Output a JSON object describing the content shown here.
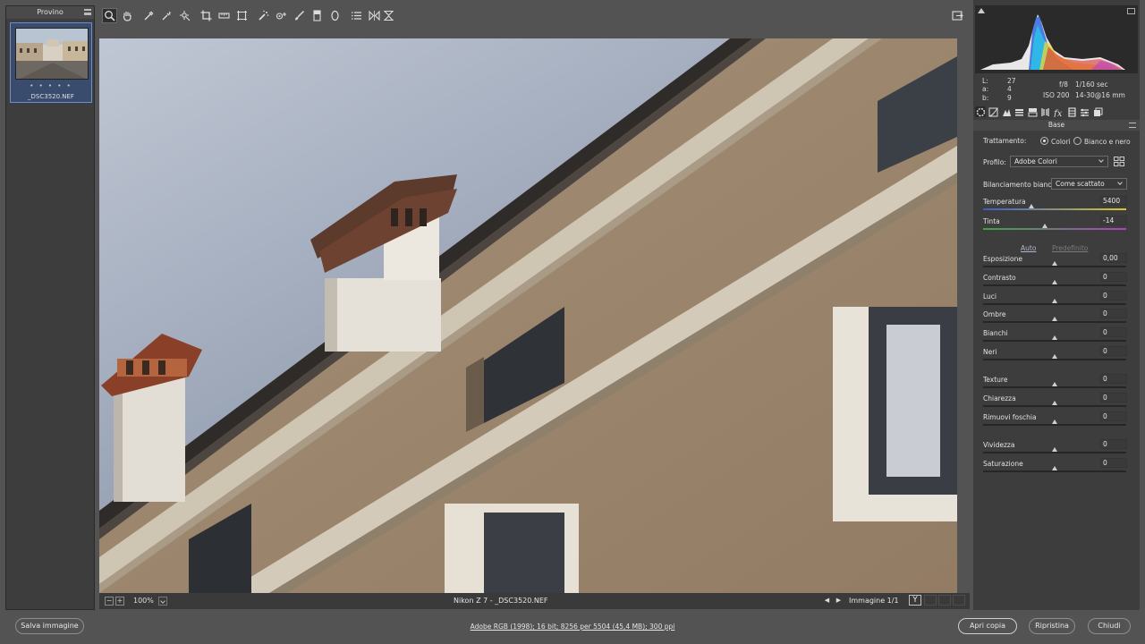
{
  "filmstrip": {
    "title": "Provino",
    "thumbnail": {
      "stars": "• • • • •",
      "filename": "_DSC3520.NEF"
    }
  },
  "toolbar": {
    "tools": [
      {
        "name": "zoom-tool-icon",
        "active": true
      },
      {
        "name": "hand-tool-icon"
      },
      {
        "name": "white-balance-tool-icon"
      },
      {
        "name": "color-sampler-tool-icon"
      },
      {
        "name": "targeted-adjustment-tool-icon"
      },
      {
        "name": "crop-tool-icon"
      },
      {
        "name": "straighten-tool-icon"
      },
      {
        "name": "transform-tool-icon"
      },
      {
        "name": "spot-removal-tool-icon"
      },
      {
        "name": "red-eye-tool-icon"
      },
      {
        "name": "adjustment-brush-icon"
      },
      {
        "name": "graduated-filter-icon"
      },
      {
        "name": "radial-filter-icon"
      },
      {
        "name": "presets-list-icon"
      },
      {
        "name": "rotate-icon"
      },
      {
        "name": "flip-icon"
      }
    ],
    "fullscreen_icon": "fullscreen-toggle-icon"
  },
  "statusbar": {
    "zoom_minus": "−",
    "zoom_plus": "+",
    "zoom": "100%",
    "file_info": "Nikon Z 7  -  _DSC3520.NEF",
    "prev": "◀",
    "next": "▶",
    "image_count": "Immagine 1/1",
    "before_after": "Y"
  },
  "readout": {
    "L_label": "L:",
    "L": "27",
    "a_label": "a:",
    "a": "4",
    "b_label": "b:",
    "b": "9"
  },
  "exif": {
    "aperture": "f/8",
    "shutter": "1/160 sec",
    "iso": "ISO 200",
    "lens": "14-30@16 mm"
  },
  "panel": {
    "section": "Base",
    "trattamento": {
      "label": "Trattamento:",
      "colori": "Colori",
      "bn": "Bianco e nero"
    },
    "profilo": {
      "label": "Profilo:",
      "value": "Adobe Colori"
    },
    "wb": {
      "label": "Bilanciamento bianco:",
      "value": "Come scattato"
    },
    "temperatura": {
      "label": "Temperatura",
      "value": "5400",
      "pos": 0.34
    },
    "tinta": {
      "label": "Tinta",
      "value": "-14",
      "pos": 0.43
    },
    "auto": "Auto",
    "predefinito": "Predefinito",
    "tone": [
      {
        "label": "Esposizione",
        "value": "0,00"
      },
      {
        "label": "Contrasto",
        "value": "0"
      },
      {
        "label": "Luci",
        "value": "0"
      },
      {
        "label": "Ombre",
        "value": "0"
      },
      {
        "label": "Bianchi",
        "value": "0"
      },
      {
        "label": "Neri",
        "value": "0"
      }
    ],
    "presence": [
      {
        "label": "Texture",
        "value": "0"
      },
      {
        "label": "Chiarezza",
        "value": "0"
      },
      {
        "label": "Rimuovi foschia",
        "value": "0"
      }
    ],
    "color": [
      {
        "label": "Vividezza",
        "value": "0"
      },
      {
        "label": "Saturazione",
        "value": "0"
      }
    ]
  },
  "bottom": {
    "save": "Salva immagine",
    "workflow": "Adobe RGB (1998); 16 bit; 8256 per 5504 (45,4 MB); 300 ppi",
    "open_copy": "Apri copia",
    "reset": "Ripristina",
    "close": "Chiudi"
  },
  "colors": {
    "accent": "#6d8fd0",
    "link": "#aeb8c8",
    "disabled": "#7a7a7a"
  }
}
